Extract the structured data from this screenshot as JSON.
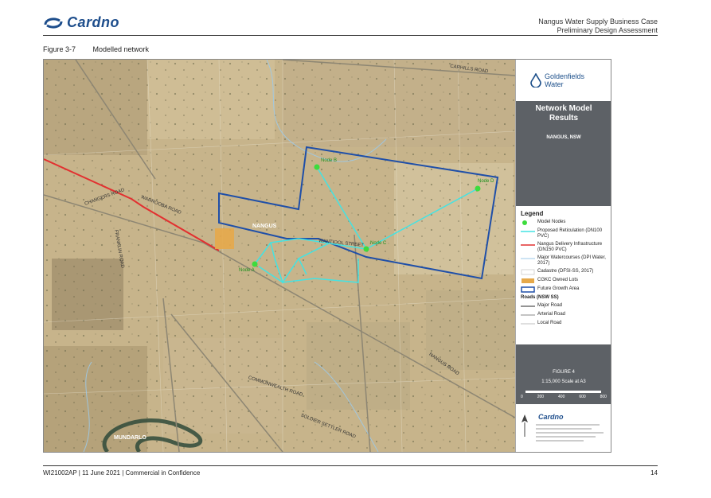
{
  "header": {
    "logo_text": "Cardno",
    "doc_title": "Nangus Water Supply Business Case",
    "doc_subtitle": "Preliminary Design Assessment"
  },
  "figure": {
    "number": "Figure 3-7",
    "caption": "Modelled network"
  },
  "map": {
    "town_labels": [
      "NANGUS",
      "MUNDARLO"
    ],
    "road_labels": [
      "CARHILLS ROAD",
      "WARROOBA ROAD",
      "WANTIOOL STREET",
      "NANGUS ROAD",
      "SOLDIER SETTLER ROAD",
      "COMMONWEALTH ROAD",
      "CHANGERS ROAD",
      "FRANKLIN ROAD"
    ],
    "nodes": [
      {
        "label": "Node A"
      },
      {
        "label": "Node B"
      },
      {
        "label": "Node C"
      },
      {
        "label": "Node D"
      }
    ],
    "colors": {
      "nodes": "#3ddc3d",
      "reticulation": "#44e3e3",
      "delivery": "#e23030",
      "growth_area": "#1f4fa8",
      "cgkc_lots": "#e6a94a"
    }
  },
  "panel": {
    "client_logo_line1": "Goldenfields",
    "client_logo_line2": "Water",
    "title_line1": "Network Model",
    "title_line2": "Results",
    "subtitle": "NANGUS, NSW",
    "legend_title": "Legend",
    "legend_items": [
      {
        "label": "Model Nodes"
      },
      {
        "label": "Proposed Reticulation (DN100 PVC)"
      },
      {
        "label": "Nangus Delivery Infrastructure (DN150 PVC)"
      },
      {
        "label": "Major Watercourses (DPI Water, 2017)"
      },
      {
        "label": "Cadastre (DFSI-SS, 2017)"
      },
      {
        "label": "CGKC Owned Lots"
      },
      {
        "label": "Future Growth Area"
      }
    ],
    "roads_title": "Roads (NSW SS)",
    "road_items": [
      {
        "label": "Major Road"
      },
      {
        "label": "Arterial Road"
      },
      {
        "label": "Local Road"
      }
    ],
    "figure_label": "FIGURE 4",
    "scale_text": "1:15,000   Scale at A3",
    "scale_ticks": [
      "0",
      "200",
      "400",
      "600",
      "800"
    ],
    "bottom_logo": "Cardno"
  },
  "footer": {
    "left": "WI21002AP | 11 June 2021 | Commercial in Confidence",
    "page": "14"
  }
}
